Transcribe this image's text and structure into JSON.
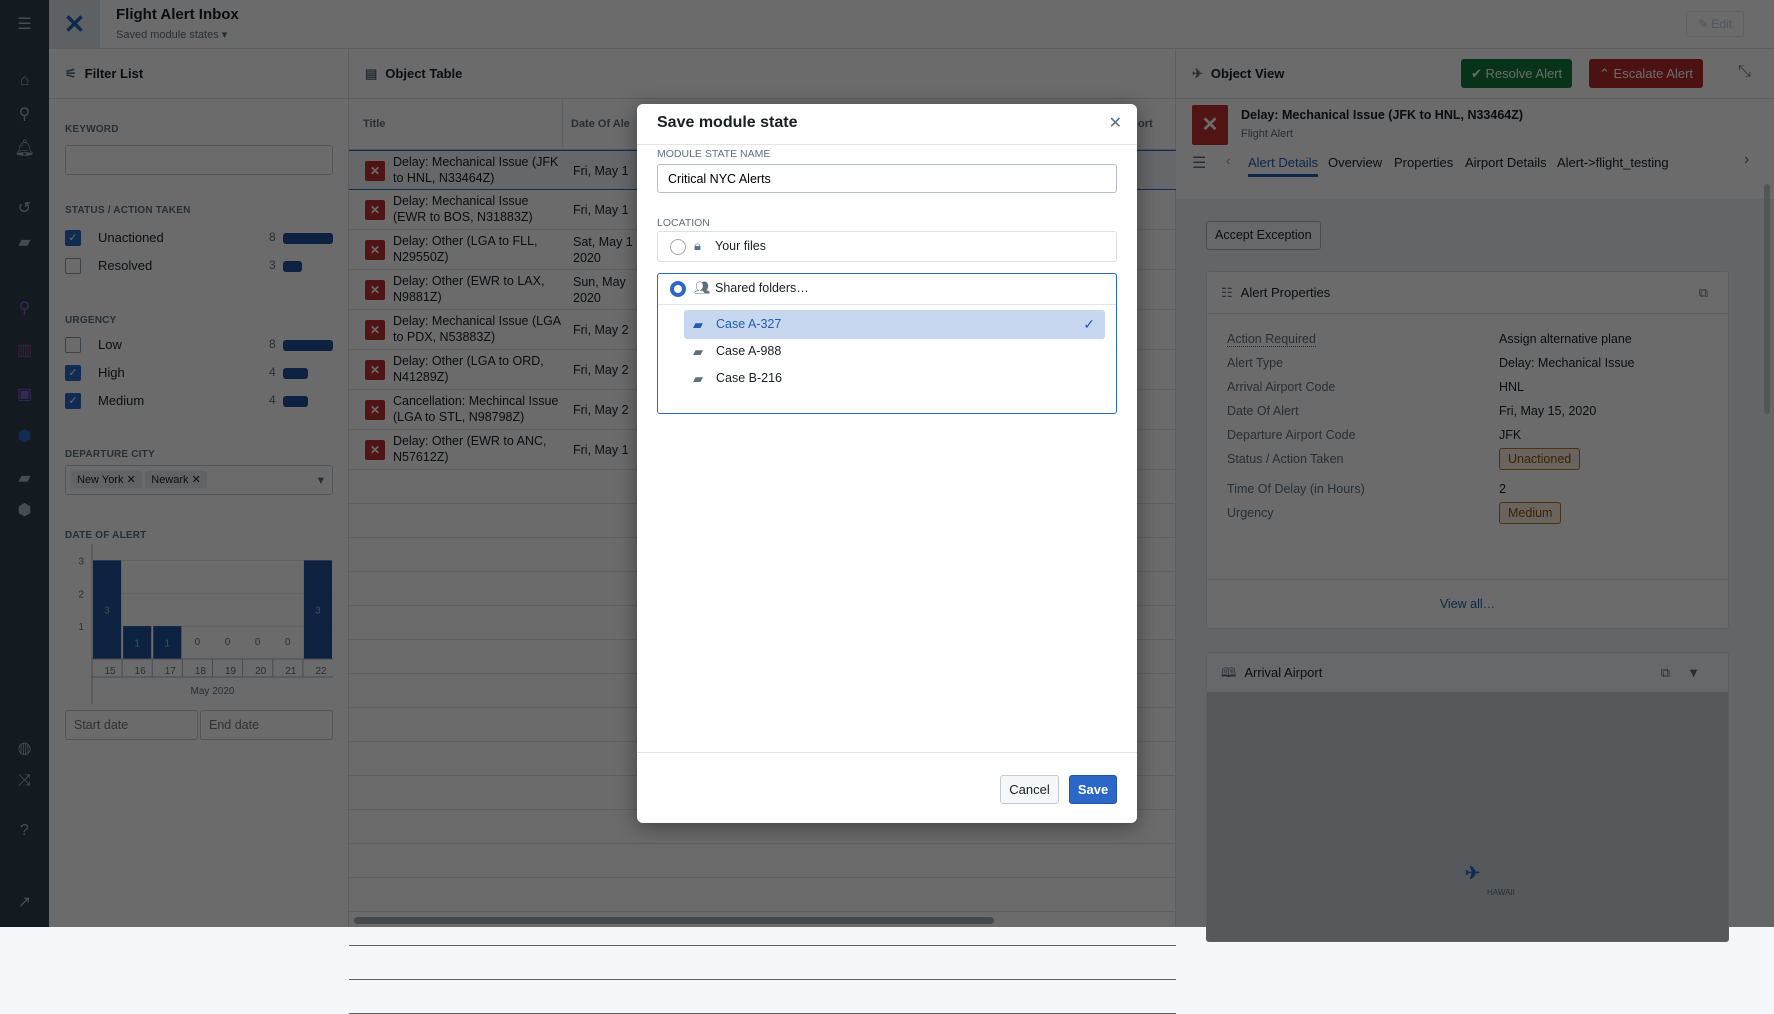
{
  "app": {
    "title": "Flight Alert Inbox",
    "subtitle": "Saved module states",
    "edit_label": "Edit"
  },
  "filter": {
    "title": "Filter List",
    "keyword_label": "KEYWORD",
    "keyword_value": "",
    "status_label": "STATUS / ACTION TAKEN",
    "status": [
      {
        "label": "Unactioned",
        "count": "8",
        "checked": true,
        "fraction": 1
      },
      {
        "label": "Resolved",
        "count": "3",
        "checked": false,
        "fraction": 0.375
      }
    ],
    "urgency_label": "URGENCY",
    "urgency": [
      {
        "label": "Low",
        "count": "8",
        "checked": false,
        "fraction": 1
      },
      {
        "label": "High",
        "count": "4",
        "checked": true,
        "fraction": 0.5
      },
      {
        "label": "Medium",
        "count": "4",
        "checked": true,
        "fraction": 0.5
      }
    ],
    "city_label": "DEPARTURE CITY",
    "cities": [
      "New York",
      "Newark"
    ],
    "date_label": "DATE OF ALERT",
    "start_placeholder": "Start date",
    "end_placeholder": "End date"
  },
  "chart_data": {
    "type": "bar",
    "categories": [
      "15",
      "16",
      "17",
      "18",
      "19",
      "20",
      "21",
      "22"
    ],
    "values": [
      3,
      1,
      1,
      0,
      0,
      0,
      0,
      3
    ],
    "xlabel": "May 2020",
    "ylabel": "",
    "yticks": [
      1,
      2,
      3
    ],
    "ylim": [
      0,
      3.5
    ],
    "bar_color": "#1f4f99"
  },
  "table": {
    "title": "Object Table",
    "columns": [
      "Title",
      "Date Of Ale",
      "ort"
    ],
    "rows": [
      {
        "title": "Delay: Mechanical Issue (JFK to HNL, N33464Z)",
        "date": [
          "Fri, May 1"
        ]
      },
      {
        "title": "Delay: Mechanical Issue (EWR to BOS, N31883Z)",
        "date": [
          "Fri, May 1"
        ]
      },
      {
        "title": "Delay: Other (LGA to FLL, N29550Z)",
        "date": [
          "Sat, May 1",
          "2020"
        ]
      },
      {
        "title": "Delay: Other (EWR to LAX, N9881Z)",
        "date": [
          "Sun, May",
          "2020"
        ]
      },
      {
        "title": "Delay: Mechanical Issue (LGA to PDX, N53883Z)",
        "date": [
          "Fri, May 2"
        ]
      },
      {
        "title": "Delay: Other (LGA to ORD, N41289Z)",
        "date": [
          "Fri, May 2"
        ]
      },
      {
        "title": "Cancellation: Mechincal Issue (LGA to STL, N98798Z)",
        "date": [
          "Fri, May 2"
        ]
      },
      {
        "title": "Delay: Other (EWR to ANC, N57612Z)",
        "date": [
          "Fri, May 1"
        ]
      }
    ]
  },
  "object_view": {
    "title": "Object View",
    "resolve_label": "Resolve Alert",
    "escalate_label": "Escalate Alert",
    "object_title": "Delay: Mechanical Issue (JFK to HNL, N33464Z)",
    "object_type": "Flight Alert",
    "tabs": [
      "Alert Details",
      "Overview",
      "Properties",
      "Airport Details",
      "Alert->flight_testing"
    ],
    "active_tab": "Alert Details",
    "accept_label": "Accept Exception",
    "props_title": "Alert Properties",
    "props": [
      {
        "k": "Action Required",
        "v": "Assign alternative plane"
      },
      {
        "k": "Alert Type",
        "v": "Delay: Mechanical Issue"
      },
      {
        "k": "Arrival Airport Code",
        "v": "HNL"
      },
      {
        "k": "Date Of Alert",
        "v": "Fri, May 15, 2020"
      },
      {
        "k": "Departure Airport Code",
        "v": "JFK"
      },
      {
        "k": "Status / Action Taken",
        "v": "Unactioned",
        "badge": true
      },
      {
        "k": "Time Of Delay (in Hours)",
        "v": "2"
      },
      {
        "k": "Urgency",
        "v": "Medium",
        "badge": true
      }
    ],
    "view_all": "View all…",
    "map_title": "Arrival Airport",
    "map_label": "HAWAII"
  },
  "modal": {
    "title": "Save module state",
    "name_label": "MODULE STATE NAME",
    "name_value": "Critical NYC Alerts",
    "location_label": "LOCATION",
    "your_files": "Your files",
    "shared_folders": "Shared folders…",
    "folders": [
      {
        "name": "Case A-327",
        "selected": true
      },
      {
        "name": "Case A-988",
        "selected": false
      },
      {
        "name": "Case B-216",
        "selected": false
      }
    ],
    "cancel_label": "Cancel",
    "save_label": "Save"
  },
  "colors": {
    "primary": "#2b67c6",
    "success": "#0f7a3e",
    "danger": "#b52b2b",
    "alert_icon": "#c23030"
  }
}
